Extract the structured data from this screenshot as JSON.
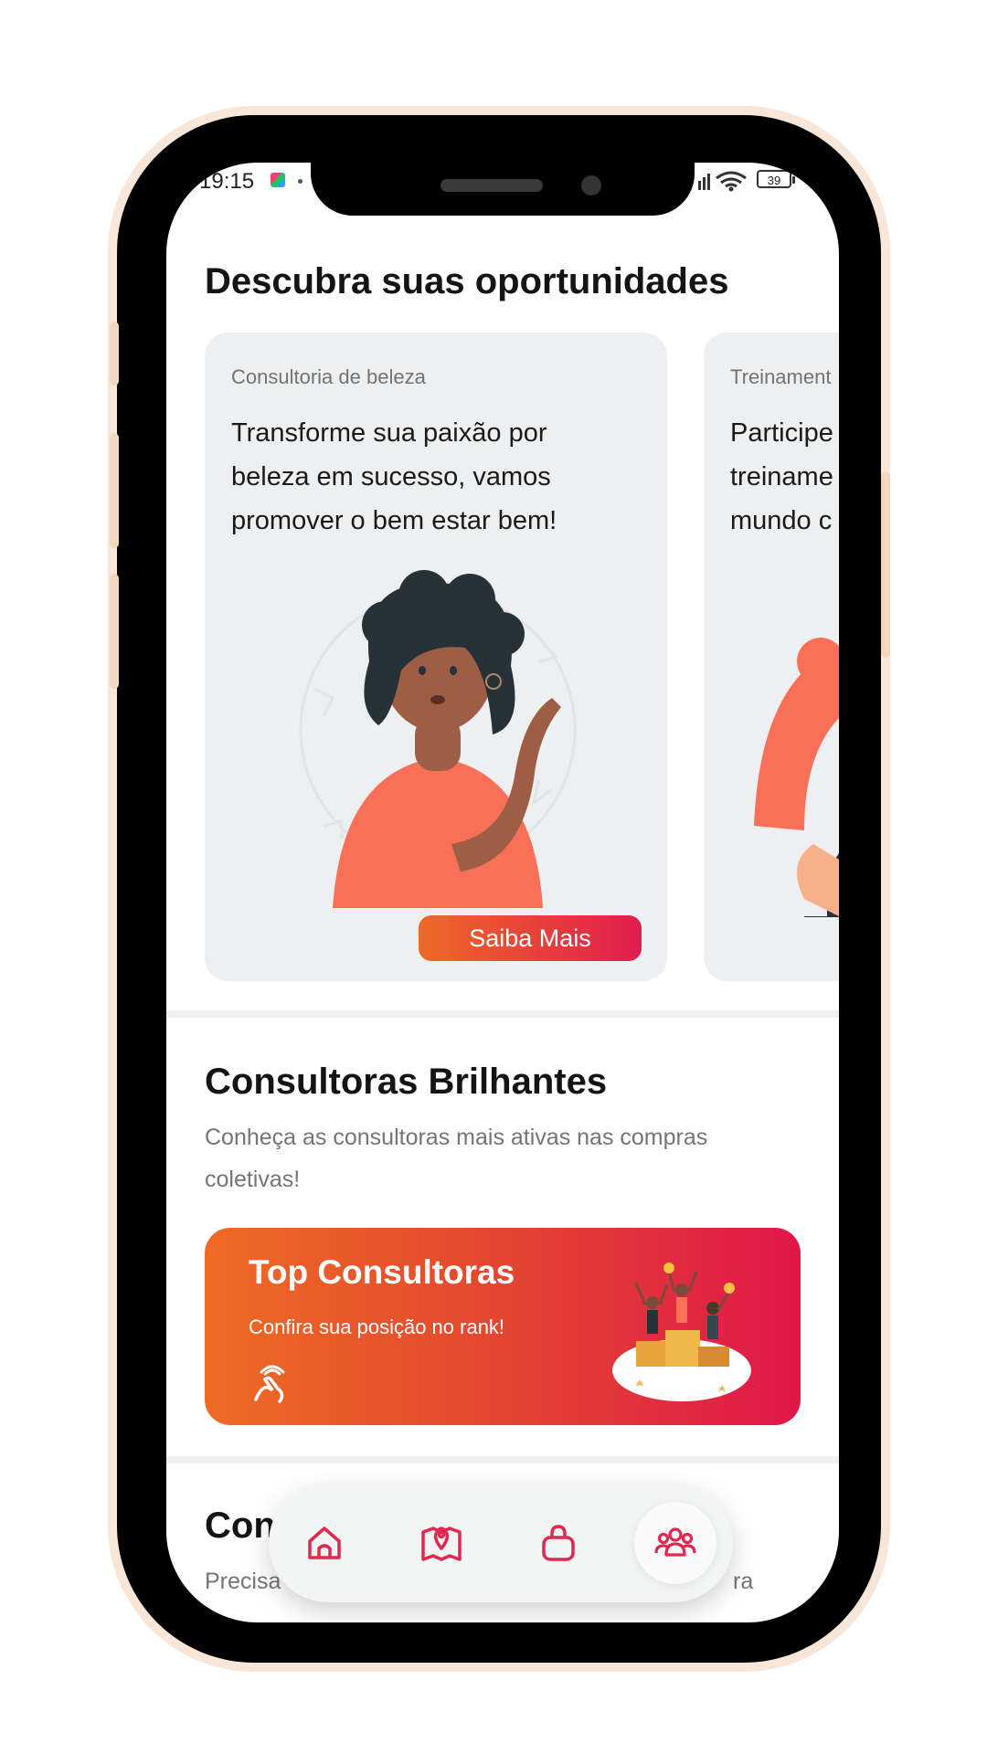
{
  "status_bar": {
    "time": "19:15",
    "battery": "39"
  },
  "opportunities": {
    "title": "Descubra suas oportunidades",
    "cards": [
      {
        "category": "Consultoria de beleza",
        "text": "Transforme sua paixão por\nbeleza em sucesso, vamos\npromover o bem estar bem!",
        "button": "Saiba Mais"
      },
      {
        "category": "Treinament",
        "text": "Participe\ntreiname\nmundo c"
      }
    ]
  },
  "brilliant": {
    "title": "Consultoras Brilhantes",
    "subtitle": "Conheça as consultoras mais ativas nas compras coletivas!",
    "banner": {
      "title": "Top Consultoras",
      "subtitle": "Confira sua posição no rank!"
    }
  },
  "contact": {
    "title": "Con",
    "subtitle": "Precisa",
    "subtitle_tail": "ra"
  },
  "bottom_nav": {
    "items": [
      {
        "icon": "home-icon"
      },
      {
        "icon": "map-pin-icon"
      },
      {
        "icon": "shopping-bag-icon"
      },
      {
        "icon": "users-icon",
        "active": true
      }
    ]
  },
  "colors": {
    "accent_start": "#ee6b24",
    "accent_end": "#e0174a",
    "nav_icon": "#e0294f"
  }
}
